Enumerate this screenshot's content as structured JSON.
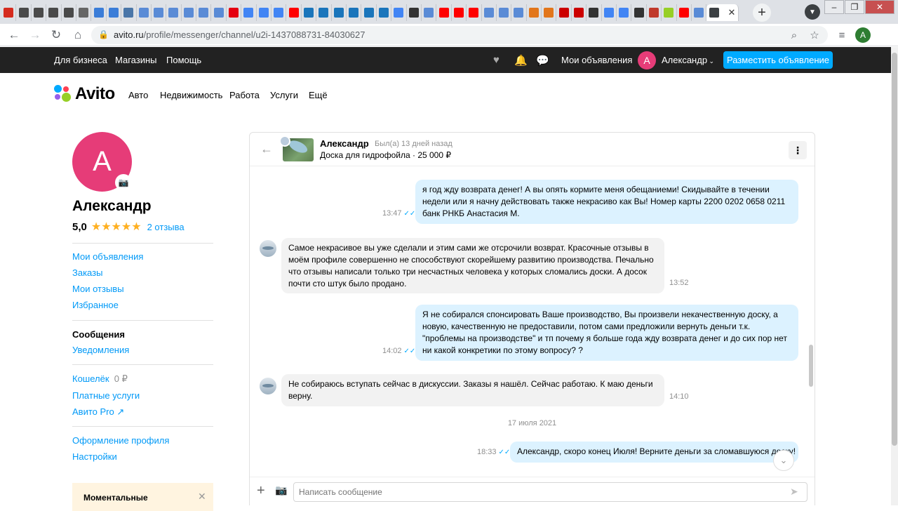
{
  "browser": {
    "tabs": [
      {
        "icon": "russia-flag-icon",
        "color": "#d52b1e"
      },
      {
        "icon": "k-icon",
        "color": "#4a4a4a"
      },
      {
        "icon": "k-icon",
        "color": "#4a4a4a"
      },
      {
        "icon": "k-icon",
        "color": "#4a4a4a"
      },
      {
        "icon": "k-icon",
        "color": "#4a4a4a"
      },
      {
        "icon": "at-icon",
        "color": "#666666"
      },
      {
        "icon": "mail-icon",
        "color": "#3b7dd8"
      },
      {
        "icon": "mail-icon",
        "color": "#3b7dd8"
      },
      {
        "icon": "vk-icon",
        "color": "#4a76a8"
      },
      {
        "icon": "page-icon",
        "color": "#5a8bd6"
      },
      {
        "icon": "page-icon",
        "color": "#5a8bd6"
      },
      {
        "icon": "page-icon",
        "color": "#5a8bd6"
      },
      {
        "icon": "page-icon",
        "color": "#5a8bd6"
      },
      {
        "icon": "page-icon",
        "color": "#5a8bd6"
      },
      {
        "icon": "page-icon",
        "color": "#5a8bd6"
      },
      {
        "icon": "hm-icon",
        "color": "#e50010"
      },
      {
        "icon": "google-icon",
        "color": "#4285f4"
      },
      {
        "icon": "google-icon",
        "color": "#4285f4"
      },
      {
        "icon": "google-icon",
        "color": "#4285f4"
      },
      {
        "icon": "youtube-icon",
        "color": "#ff0000"
      },
      {
        "icon": "de-icon",
        "color": "#1a75bb"
      },
      {
        "icon": "de-icon",
        "color": "#1a75bb"
      },
      {
        "icon": "de-icon",
        "color": "#1a75bb"
      },
      {
        "icon": "de-icon",
        "color": "#1a75bb"
      },
      {
        "icon": "de-icon",
        "color": "#1a75bb"
      },
      {
        "icon": "de-icon",
        "color": "#1a75bb"
      },
      {
        "icon": "google-icon",
        "color": "#4285f4"
      },
      {
        "icon": "infinity-icon",
        "color": "#333333"
      },
      {
        "icon": "page-icon",
        "color": "#5a8bd6"
      },
      {
        "icon": "youtube-icon",
        "color": "#ff0000"
      },
      {
        "icon": "youtube-icon",
        "color": "#ff0000"
      },
      {
        "icon": "youtube-icon",
        "color": "#ff0000"
      },
      {
        "icon": "page-icon",
        "color": "#5a8bd6"
      },
      {
        "icon": "page-icon",
        "color": "#5a8bd6"
      },
      {
        "icon": "page-icon",
        "color": "#5a8bd6"
      },
      {
        "icon": "fox-icon",
        "color": "#e2761b"
      },
      {
        "icon": "fox-icon",
        "color": "#e2761b"
      },
      {
        "icon": "star-icon",
        "color": "#cc0000"
      },
      {
        "icon": "star-icon",
        "color": "#cc0000"
      },
      {
        "icon": "github-icon",
        "color": "#333333"
      },
      {
        "icon": "google-icon",
        "color": "#4285f4"
      },
      {
        "icon": "google-icon",
        "color": "#4285f4"
      },
      {
        "icon": "github-icon",
        "color": "#333333"
      },
      {
        "icon": "u-icon",
        "color": "#c0392b"
      },
      {
        "icon": "avito-icon",
        "color": "#97cf26"
      },
      {
        "icon": "youtube-icon",
        "color": "#ff0000"
      },
      {
        "icon": "page-icon",
        "color": "#5a8bd6"
      }
    ],
    "url_host": "avito.ru",
    "url_path": "/profile/messenger/channel/u2i-1437088731-84030627",
    "account_initial": "A"
  },
  "topbar": {
    "for_business": "Для бизнеса",
    "shops": "Магазины",
    "help": "Помощь",
    "my_ads": "Мои объявления",
    "user_initial": "А",
    "user_name": "Александр",
    "post_ad": "Разместить объявление"
  },
  "header": {
    "logo": "Avito",
    "nav": [
      "Авто",
      "Недвижимость",
      "Работа",
      "Услуги",
      "Ещё"
    ]
  },
  "profile": {
    "initial": "А",
    "name": "Александр",
    "rating": "5,0",
    "stars": "★★★★★",
    "reviews": "2 отзыва"
  },
  "menu": {
    "my_ads": "Мои объявления",
    "orders": "Заказы",
    "my_reviews": "Мои отзывы",
    "favorites": "Избранное",
    "messages": "Сообщения",
    "notifications": "Уведомления",
    "wallet": "Кошелёк",
    "wallet_amount": "0 ₽",
    "paid_services": "Платные услуги",
    "avito_pro": "Авито Pro ↗",
    "profile_design": "Оформление профиля",
    "settings": "Настройки"
  },
  "promo": {
    "title": "Моментальные"
  },
  "chat": {
    "name": "Александр",
    "last_seen": "Был(а) 13 дней назад",
    "item": "Доска для гидрофойла · 25 000 ₽",
    "messages": [
      {
        "dir": "out",
        "text": "я год жду возврата денег! А вы опять кормите меня обещаниеми! Скидывайте в течении недели или я начну действовать также некрасиво как Вы!  Номер карты 2200 0202 0658 0211 банк РНКБ Анастасия М.",
        "time": "13:47"
      },
      {
        "dir": "in",
        "text": "Самое некрасивое вы уже сделали и этим сами же отсрочили возврат. Красочные отзывы в моём профиле совершенно не способствуют скорейшему развитию производства. Печально что отзывы написали только три несчастных человека у которых сломались доски. А досок почти сто штук было продано.",
        "time": "13:52"
      },
      {
        "dir": "out",
        "text": "Я не собирался спонсировать Ваше производство, Вы произвели некачественную доску, а новую, качественную не предоставили, потом сами предложили вернуть деньги т.к. \"проблемы на производстве\" и тп почему я больше года жду возврата денег и до сих пор нет ни какой конкретики по этому вопросу? ?",
        "time": "14:02"
      },
      {
        "dir": "in",
        "text": "Не собираюсь вступать сейчас в дискуссии. Заказы я нашёл. Сейчас работаю. К маю деньги верну.",
        "time": "14:10"
      },
      {
        "dir": "out",
        "text": "Александр, скоро конец Июля! Верните деньги за сломавшуюся доску!",
        "time": "18:33"
      }
    ],
    "date_separator": "17 июля 2021",
    "input_placeholder": "Написать сообщение"
  },
  "colors": {
    "accent": "#00aaff",
    "link": "#0099f7",
    "avatar": "#e63c78",
    "outgoing_bubble": "#dcf2ff",
    "incoming_bubble": "#f2f2f2"
  }
}
